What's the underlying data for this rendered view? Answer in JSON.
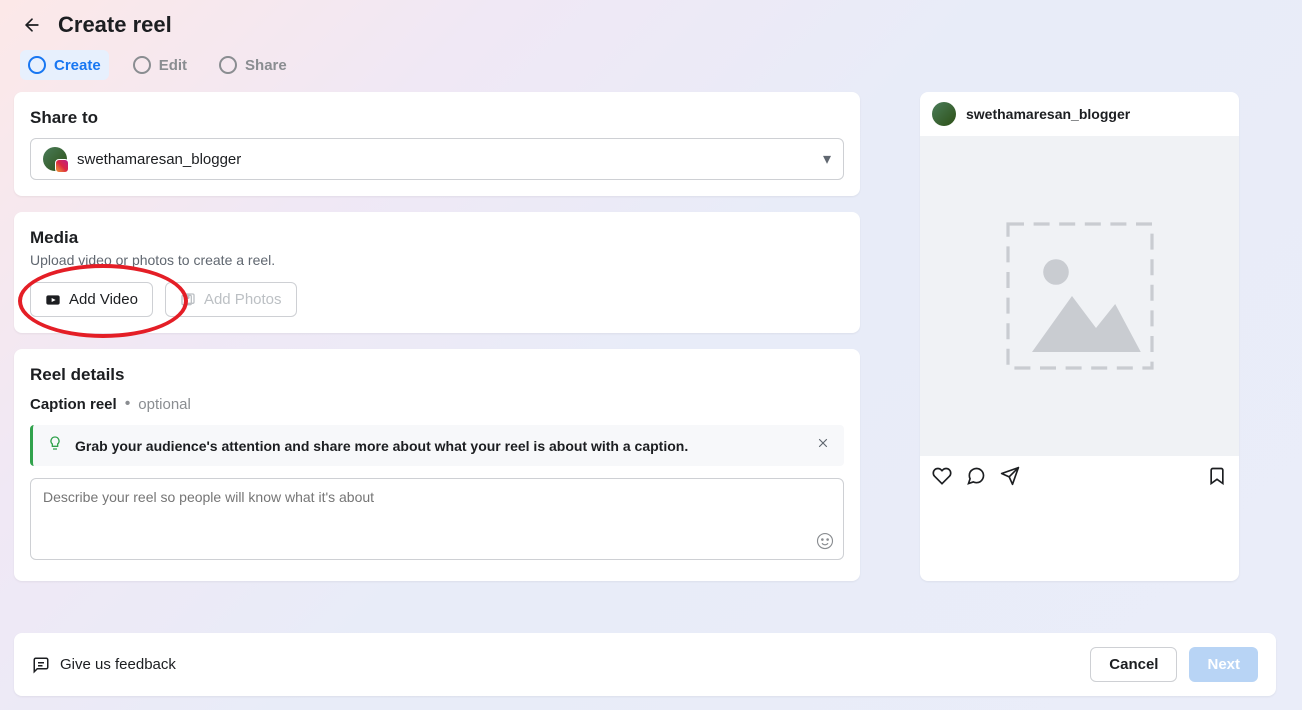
{
  "header": {
    "title": "Create reel"
  },
  "tabs": [
    {
      "label": "Create",
      "active": true
    },
    {
      "label": "Edit",
      "active": false
    },
    {
      "label": "Share",
      "active": false
    }
  ],
  "share_to": {
    "title": "Share to",
    "account": "swethamaresan_blogger"
  },
  "media": {
    "title": "Media",
    "subtitle": "Upload video or photos to create a reel.",
    "add_video": "Add Video",
    "add_photos": "Add Photos"
  },
  "details": {
    "title": "Reel details",
    "caption_label": "Caption reel",
    "optional": "optional",
    "tip": "Grab your audience's attention and share more about what your reel is about with a caption.",
    "placeholder": "Describe your reel so people will know what it's about"
  },
  "footer": {
    "feedback": "Give us feedback",
    "cancel": "Cancel",
    "next": "Next"
  },
  "preview": {
    "username": "swethamaresan_blogger"
  }
}
